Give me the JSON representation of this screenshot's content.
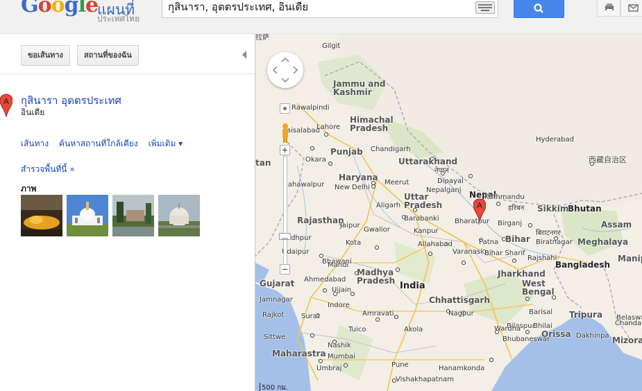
{
  "header": {
    "logo_word": "Google",
    "product_name": "แผนที่",
    "product_sub": "ประเทศไทย",
    "search_value": "กุสินารา, อุตตรประเทศ, อินเดีย"
  },
  "left_panel": {
    "buttons": {
      "directions": "ขอเส้นทาง",
      "my_places": "สถานที่ของฉัน"
    },
    "result": {
      "marker_letter": "A",
      "title": "กุสินารา อุตตรประเทศ",
      "subtitle": "อินเดีย",
      "links": {
        "directions": "เส้นทาง",
        "search_nearby": "ค้นหาสถานที่ใกล้เคียง",
        "more": "เพิ่มเติม ▾"
      },
      "explore": "สำรวจพื้นที่นี้ »",
      "photos_heading": "ภาพ"
    }
  },
  "map": {
    "marker_letter": "A",
    "scale_label": "500 กม.",
    "labels": [
      {
        "text": "Gilgit",
        "cls": ""
      },
      {
        "text": "Jammu and\nKashmir",
        "cls": "state"
      },
      {
        "text": "Rawalpindi",
        "cls": ""
      },
      {
        "text": "Faisalabad",
        "cls": ""
      },
      {
        "text": "Lahore",
        "cls": ""
      },
      {
        "text": "Himachal\nPradesh",
        "cls": "state"
      },
      {
        "text": "Punjab",
        "cls": "state"
      },
      {
        "text": "Chandigarh",
        "cls": ""
      },
      {
        "text": "Uttarakhand",
        "cls": "state"
      },
      {
        "text": "Okara",
        "cls": ""
      },
      {
        "text": "tan",
        "cls": "state"
      },
      {
        "text": "Haryana",
        "cls": "state"
      },
      {
        "text": "New Delhi",
        "cls": ""
      },
      {
        "text": "Meerut",
        "cls": ""
      },
      {
        "text": "Bahawalpur",
        "cls": ""
      },
      {
        "text": "नेपाल",
        "cls": ""
      },
      {
        "text": "Dipayal",
        "cls": ""
      },
      {
        "text": "Nepalganj",
        "cls": ""
      },
      {
        "text": "Nepal",
        "cls": "country"
      },
      {
        "text": "Kathmandu",
        "cls": ""
      },
      {
        "text": "Bhutan",
        "cls": "country"
      },
      {
        "text": "Sikkim",
        "cls": "state"
      },
      {
        "text": "Uttar\nPradesh",
        "cls": "state"
      },
      {
        "text": "Aligarh",
        "cls": ""
      },
      {
        "text": "Bharatpur",
        "cls": ""
      },
      {
        "text": "Birganj",
        "cls": ""
      },
      {
        "text": "हरिबन",
        "cls": ""
      },
      {
        "text": "Assam",
        "cls": "state"
      },
      {
        "text": "Rajasthan",
        "cls": "state"
      },
      {
        "text": "Jaipur",
        "cls": ""
      },
      {
        "text": "Barabanki",
        "cls": ""
      },
      {
        "text": "Gwalior",
        "cls": ""
      },
      {
        "text": "Kanpur",
        "cls": ""
      },
      {
        "text": "बिराटनगर",
        "cls": ""
      },
      {
        "text": "Biratnagar",
        "cls": ""
      },
      {
        "text": "Meghalaya",
        "cls": "state"
      },
      {
        "text": "Jodhpur",
        "cls": ""
      },
      {
        "text": "Kota",
        "cls": ""
      },
      {
        "text": "Allahabad",
        "cls": ""
      },
      {
        "text": "Patna",
        "cls": ""
      },
      {
        "text": "Bihar",
        "cls": "state"
      },
      {
        "text": "Varanasi",
        "cls": ""
      },
      {
        "text": "Bihar Sharif",
        "cls": ""
      },
      {
        "text": "Udaipur",
        "cls": ""
      },
      {
        "text": "Bhawani",
        "cls": ""
      },
      {
        "text": "Mandi",
        "cls": ""
      },
      {
        "text": "Rajshahi",
        "cls": ""
      },
      {
        "text": "Bangladesh",
        "cls": "country"
      },
      {
        "text": "Manip",
        "cls": "state"
      },
      {
        "text": "Jharkhand",
        "cls": "state"
      },
      {
        "text": "Madhya\nPradesh",
        "cls": "state"
      },
      {
        "text": "Ahmedabad",
        "cls": ""
      },
      {
        "text": "Gujarat",
        "cls": "state"
      },
      {
        "text": "Ujjain",
        "cls": ""
      },
      {
        "text": "India",
        "cls": "big"
      },
      {
        "text": "West\nBengal",
        "cls": "state"
      },
      {
        "text": "Jamnagar",
        "cls": ""
      },
      {
        "text": "Indore",
        "cls": ""
      },
      {
        "text": "Chhattisgarh",
        "cls": "state"
      },
      {
        "text": "Tripura",
        "cls": "state"
      },
      {
        "text": "Barisal",
        "cls": ""
      },
      {
        "text": "Rajkot",
        "cls": ""
      },
      {
        "text": "Surat",
        "cls": ""
      },
      {
        "text": "Amravati",
        "cls": ""
      },
      {
        "text": "Nagpur",
        "cls": ""
      },
      {
        "text": "Bilaspur",
        "cls": ""
      },
      {
        "text": "Bhilai",
        "cls": ""
      },
      {
        "text": "Belaswar",
        "cls": ""
      },
      {
        "text": "Tuico",
        "cls": ""
      },
      {
        "text": "Akola",
        "cls": ""
      },
      {
        "text": "Wardha",
        "cls": ""
      },
      {
        "text": "Orissa",
        "cls": "state"
      },
      {
        "text": "Bhubaneswar",
        "cls": ""
      },
      {
        "text": "Chandanpur",
        "cls": ""
      },
      {
        "text": "Dakhinpa",
        "cls": ""
      },
      {
        "text": "Mizoram",
        "cls": "state"
      },
      {
        "text": "Sittwe",
        "cls": ""
      },
      {
        "text": "Nashik",
        "cls": ""
      },
      {
        "text": "Maharastra",
        "cls": "state"
      },
      {
        "text": "Mumbai",
        "cls": ""
      },
      {
        "text": "Umbraj",
        "cls": ""
      },
      {
        "text": "Pune",
        "cls": ""
      },
      {
        "text": "Hanamkonda",
        "cls": ""
      },
      {
        "text": "Vishakhapatnam",
        "cls": ""
      },
      {
        "text": "Hyderabad",
        "cls": ""
      },
      {
        "text": "西藏自治区",
        "cls": "tib"
      },
      {
        "text": "拉萨",
        "cls": ""
      }
    ]
  }
}
